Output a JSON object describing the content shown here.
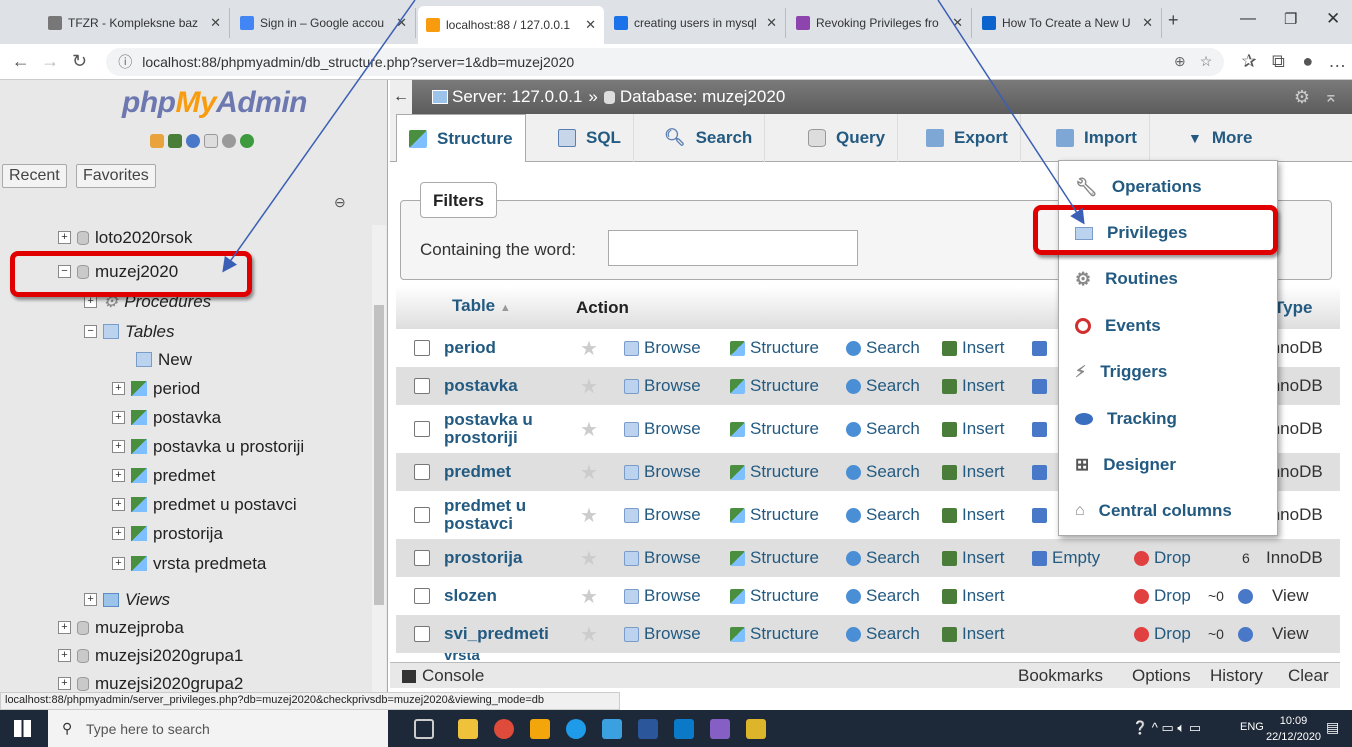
{
  "browser": {
    "tabs": [
      {
        "label": "TFZR - Kompleksne baz",
        "color": "#777777"
      },
      {
        "label": "Sign in – Google accou",
        "color": "#4285f4"
      },
      {
        "label": "localhost:88 / 127.0.0.1",
        "color": "#f89c0e"
      },
      {
        "label": "creating users in mysql",
        "color": "#1a73e8"
      },
      {
        "label": "Revoking Privileges fro",
        "color": "#8e44ad"
      },
      {
        "label": "How To Create a New U",
        "color": "#0b63ce"
      }
    ],
    "url": "localhost:88/phpmyadmin/db_structure.php?server=1&db=muzej2020",
    "status_url": "localhost:88/phpmyadmin/server_privileges.php?db=muzej2020&checkprivsdb=muzej2020&viewing_mode=db"
  },
  "sidebar": {
    "logo": {
      "php": "php",
      "my": "My",
      "admin": "Admin"
    },
    "recent": "Recent",
    "favorites": "Favorites",
    "tree": [
      {
        "label": "loto2020rsok",
        "type": "db"
      },
      {
        "label": "muzej2020",
        "type": "db"
      },
      {
        "label": "Procedures",
        "type": "group"
      },
      {
        "label": "Tables",
        "type": "group"
      },
      {
        "label": "New",
        "type": "new"
      },
      {
        "label": "period",
        "type": "table"
      },
      {
        "label": "postavka",
        "type": "table"
      },
      {
        "label": "postavka u prostoriji",
        "type": "table"
      },
      {
        "label": "predmet",
        "type": "table"
      },
      {
        "label": "predmet u postavci",
        "type": "table"
      },
      {
        "label": "prostorija",
        "type": "table"
      },
      {
        "label": "vrsta predmeta",
        "type": "table"
      },
      {
        "label": "Views",
        "type": "group"
      },
      {
        "label": "muzejproba",
        "type": "db"
      },
      {
        "label": "muzejsi2020grupa1",
        "type": "db"
      },
      {
        "label": "muzejsi2020grupa2",
        "type": "db"
      }
    ]
  },
  "breadcrumb": {
    "server": "Server: 127.0.0.1",
    "sep": "»",
    "database": "Database: muzej2020"
  },
  "tabs": [
    "Structure",
    "SQL",
    "Search",
    "Query",
    "Export",
    "Import",
    "More"
  ],
  "filters": {
    "legend": "Filters",
    "label": "Containing the word:",
    "value": ""
  },
  "table_header": {
    "table": "Table",
    "action": "Action",
    "type": "Type"
  },
  "actions": {
    "browse": "Browse",
    "structure": "Structure",
    "search": "Search",
    "insert": "Insert",
    "empty": "Empty",
    "drop": "Drop"
  },
  "rows": [
    {
      "name": "period",
      "type": "InnoDB"
    },
    {
      "name": "postavka",
      "type": "InnoDB"
    },
    {
      "name": "postavka u prostoriji",
      "type": "InnoDB"
    },
    {
      "name": "predmet",
      "type": "InnoDB"
    },
    {
      "name": "predmet u postavci",
      "type": "InnoDB"
    },
    {
      "name": "prostorija",
      "type": "InnoDB",
      "rows": "6"
    },
    {
      "name": "slozen",
      "type": "View",
      "rows": "~0"
    },
    {
      "name": "svi_predmeti",
      "type": "View",
      "rows": "~0"
    },
    {
      "name": "vrsta",
      "type": ""
    }
  ],
  "more_menu": [
    "Operations",
    "Privileges",
    "Routines",
    "Events",
    "Triggers",
    "Tracking",
    "Designer",
    "Central columns"
  ],
  "console": {
    "label": "Console",
    "links": [
      "Bookmarks",
      "Options",
      "History",
      "Clear"
    ]
  },
  "taskbar": {
    "search_placeholder": "Type here to search",
    "lang": "ENG",
    "time": "10:09",
    "date": "22/12/2020"
  }
}
